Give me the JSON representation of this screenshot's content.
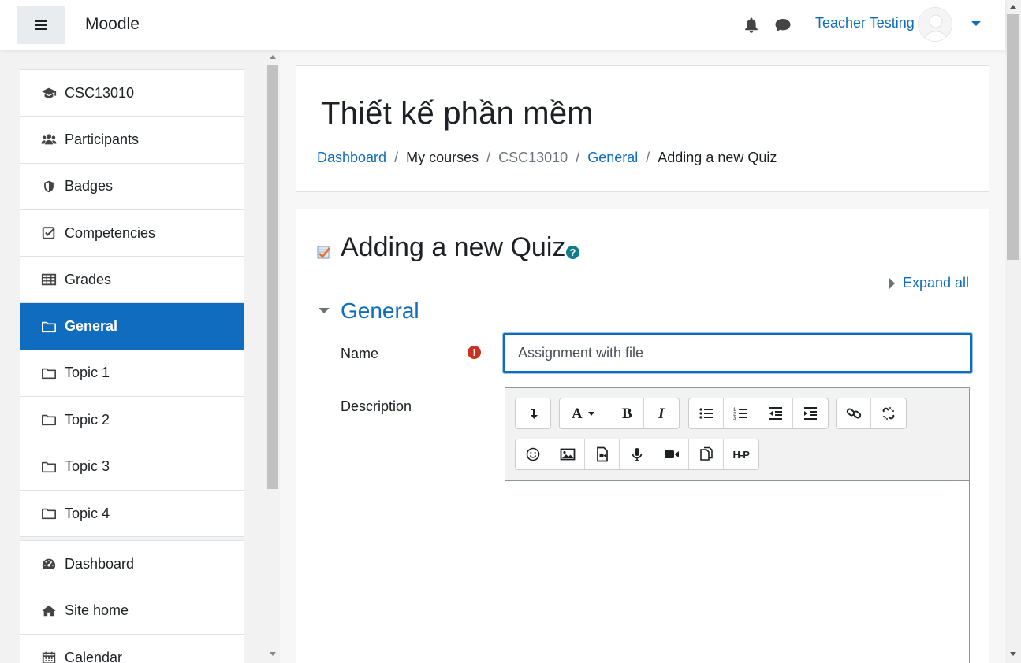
{
  "navbar": {
    "brand": "Moodle",
    "user_name": "Teacher Testing",
    "icons": [
      "menu-icon",
      "bell-icon",
      "chat-icon",
      "avatar",
      "caret-down-icon"
    ]
  },
  "drawer": {
    "course_items": [
      {
        "label": "CSC13010",
        "icon": "graduation-cap-icon"
      },
      {
        "label": "Participants",
        "icon": "users-icon"
      },
      {
        "label": "Badges",
        "icon": "shield-icon"
      },
      {
        "label": "Competencies",
        "icon": "check-square-icon"
      },
      {
        "label": "Grades",
        "icon": "table-icon"
      },
      {
        "label": "General",
        "icon": "folder-icon",
        "active": true
      },
      {
        "label": "Topic 1",
        "icon": "folder-icon"
      },
      {
        "label": "Topic 2",
        "icon": "folder-icon"
      },
      {
        "label": "Topic 3",
        "icon": "folder-icon"
      },
      {
        "label": "Topic 4",
        "icon": "folder-icon"
      }
    ],
    "site_items": [
      {
        "label": "Dashboard",
        "icon": "tachometer-icon"
      },
      {
        "label": "Site home",
        "icon": "home-icon"
      },
      {
        "label": "Calendar",
        "icon": "calendar-icon"
      }
    ]
  },
  "header": {
    "course_title": "Thiết kế phần mềm",
    "breadcrumb": [
      "Dashboard",
      "My courses",
      "CSC13010",
      "General",
      "Adding a new Quiz"
    ]
  },
  "form": {
    "heading": "Adding a new Quiz",
    "help_icon": "?",
    "expand_all": "Expand all",
    "section_title": "General",
    "name_label": "Name",
    "required_icon": "!",
    "name_value": "Assignment with file",
    "description_label": "Description",
    "toolbar_row1": [
      "show-more-icon",
      "font-icon",
      "bold-icon",
      "italic-icon",
      "unordered-list-icon",
      "ordered-list-icon",
      "outdent-icon",
      "indent-icon",
      "link-icon",
      "unlink-icon"
    ],
    "toolbar_row2": [
      "emoji-icon",
      "image-icon",
      "media-icon",
      "record-audio-icon",
      "record-video-icon",
      "manage-files-icon",
      "h5p-icon"
    ],
    "h5p_label": "H-P"
  },
  "colors": {
    "brand_blue": "#0f6cbf",
    "active_bg": "#0f6cbf",
    "required_red": "#ca3120",
    "help_teal": "#0f7d8c"
  }
}
